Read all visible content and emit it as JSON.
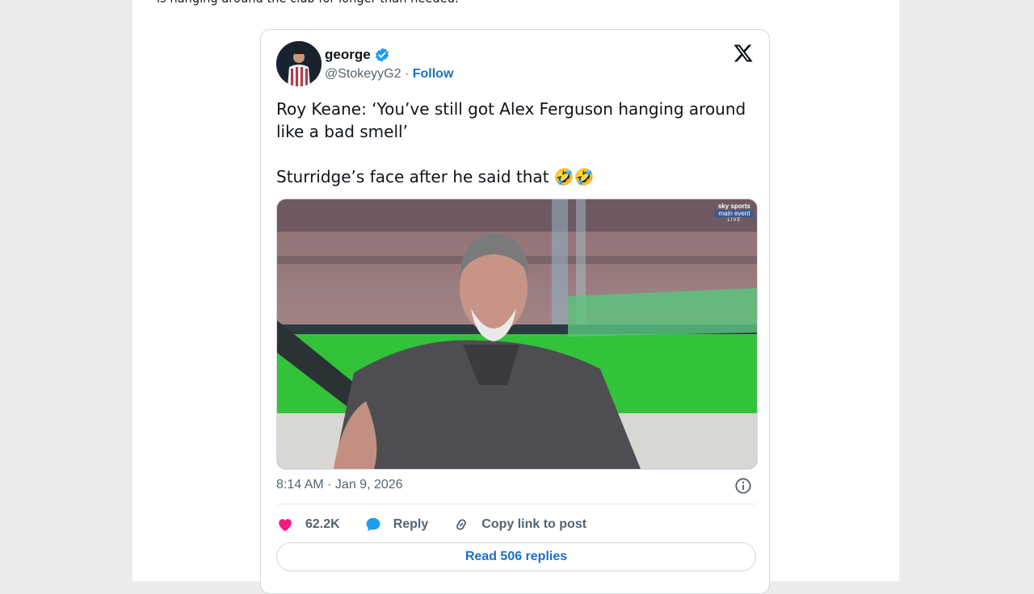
{
  "article": {
    "text": "is hanging around the club for longer than needed."
  },
  "tweet": {
    "author": {
      "name": "george",
      "handle": "@StokeyyG2",
      "separator": "·",
      "follow_label": "Follow",
      "verified": true
    },
    "text_line1": "Roy Keane: ‘You’ve still got Alex Ferguson hanging around like a bad smell’",
    "text_line2": "Sturridge’s face after he said that",
    "emoji": "🤣🤣",
    "media": {
      "broadcaster_line1": "sky sports",
      "broadcaster_line2": "main event",
      "broadcaster_line3": "LIVE"
    },
    "timestamp": "8:14 AM · Jan 9, 2026",
    "actions": {
      "likes": "62.2K",
      "reply_label": "Reply",
      "copy_link_label": "Copy link to post"
    },
    "read_replies_label": "Read 506 replies"
  },
  "colors": {
    "accent": "#1d6fc4",
    "verified": "#1d9bf0",
    "like": "#f91880",
    "muted": "#536471",
    "text": "#0f1419"
  },
  "icons": {
    "verified": "verified-badge-icon",
    "x_logo": "x-logo-icon",
    "info": "info-icon",
    "like": "heart-icon",
    "reply": "speech-bubble-icon",
    "copy_link": "link-icon"
  }
}
